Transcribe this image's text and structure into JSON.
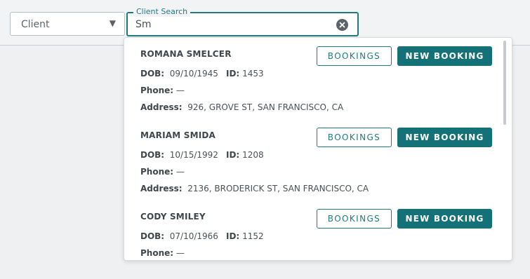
{
  "filter": {
    "selected": "Client"
  },
  "search": {
    "label": "Client Search",
    "value": "Sm"
  },
  "labels": {
    "dob": "DOB:",
    "id": "ID:",
    "phone": "Phone:",
    "address": "Address:",
    "bookings_button": "BOOKINGS",
    "new_booking_button": "NEW BOOKING"
  },
  "results": [
    {
      "name": "ROMANA SMELCER",
      "dob": "09/10/1945",
      "id": "1453",
      "phone": "—",
      "address": "926, GROVE ST, SAN FRANCISCO, CA"
    },
    {
      "name": "MARIAM SMIDA",
      "dob": "10/15/1992",
      "id": "1208",
      "phone": "—",
      "address": "2136, BRODERICK ST, SAN FRANCISCO, CA"
    },
    {
      "name": "CODY SMILEY",
      "dob": "07/10/1966",
      "id": "1152",
      "phone": "—",
      "address": ""
    }
  ],
  "colors": {
    "accent": "#147178",
    "background": "#eef0f2"
  }
}
